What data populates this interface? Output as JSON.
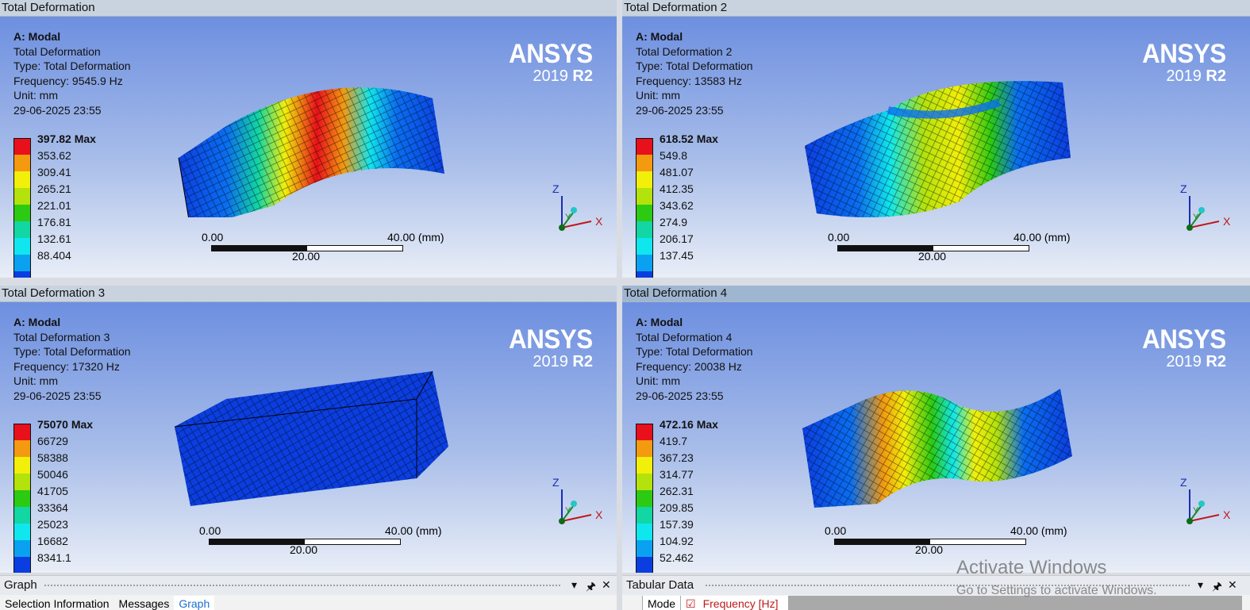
{
  "panes": [
    {
      "title": "Total Deformation",
      "info": [
        "A: Modal",
        "Total Deformation",
        "Type: Total Deformation",
        "Frequency: 9545.9 Hz",
        "Unit: mm",
        "29-06-2025 23:55"
      ],
      "legend": [
        "397.82 Max",
        "353.62",
        "309.41",
        "265.21",
        "221.01",
        "176.81",
        "132.61",
        "88.404"
      ],
      "scale": {
        "start": "0.00",
        "mid": "20.00",
        "end": "40.00 (mm)"
      },
      "brand": {
        "name": "ANSYS",
        "year": "2019",
        "release": "R2"
      },
      "axes": {
        "z": "Z",
        "y": "Y",
        "x": "X"
      }
    },
    {
      "title": "Total Deformation 2",
      "info": [
        "A: Modal",
        "Total Deformation 2",
        "Type: Total Deformation",
        "Frequency: 13583 Hz",
        "Unit: mm",
        "29-06-2025 23:55"
      ],
      "legend": [
        "618.52 Max",
        "549.8",
        "481.07",
        "412.35",
        "343.62",
        "274.9",
        "206.17",
        "137.45"
      ],
      "scale": {
        "start": "0.00",
        "mid": "20.00",
        "end": "40.00 (mm)"
      },
      "brand": {
        "name": "ANSYS",
        "year": "2019",
        "release": "R2"
      },
      "axes": {
        "z": "Z",
        "y": "Y",
        "x": "X"
      }
    },
    {
      "title": "Total Deformation 3",
      "info": [
        "A: Modal",
        "Total Deformation 3",
        "Type: Total Deformation",
        "Frequency: 17320 Hz",
        "Unit: mm",
        "29-06-2025 23:55"
      ],
      "legend": [
        "75070 Max",
        "66729",
        "58388",
        "50046",
        "41705",
        "33364",
        "25023",
        "16682",
        "8341.1"
      ],
      "scale": {
        "start": "0.00",
        "mid": "20.00",
        "end": "40.00 (mm)"
      },
      "brand": {
        "name": "ANSYS",
        "year": "2019",
        "release": "R2"
      },
      "axes": {
        "z": "Z",
        "y": "Y",
        "x": "X"
      }
    },
    {
      "title": "Total Deformation 4",
      "info": [
        "A: Modal",
        "Total Deformation 4",
        "Type: Total Deformation",
        "Frequency: 20038 Hz",
        "Unit: mm",
        "29-06-2025 23:55"
      ],
      "legend": [
        "472.16 Max",
        "419.7",
        "367.23",
        "314.77",
        "262.31",
        "209.85",
        "157.39",
        "104.92",
        "52.462"
      ],
      "scale": {
        "start": "0.00",
        "mid": "20.00",
        "end": "40.00 (mm)"
      },
      "brand": {
        "name": "ANSYS",
        "year": "2019",
        "release": "R2"
      },
      "axes": {
        "z": "Z",
        "y": "Y",
        "x": "X"
      }
    }
  ],
  "legend_colors": [
    "#e8101a",
    "#f39a10",
    "#f2ef0a",
    "#b4e20c",
    "#2cca12",
    "#12d6a4",
    "#10e6ee",
    "#0aa2f0",
    "#0b3ee0"
  ],
  "graph_panel": {
    "title": "Graph",
    "tabs": [
      "Selection Information",
      "Messages",
      "Graph"
    ],
    "pin": "▾",
    "pin2": "🖈",
    "close": "✕"
  },
  "tabular_panel": {
    "title": "Tabular Data",
    "columns": [
      "Mode",
      "Frequency [Hz]"
    ],
    "pin": "▾",
    "pin2": "🖈",
    "close": "✕"
  },
  "watermark": {
    "line1": "Activate Windows",
    "line2": "Go to Settings to activate Windows."
  }
}
